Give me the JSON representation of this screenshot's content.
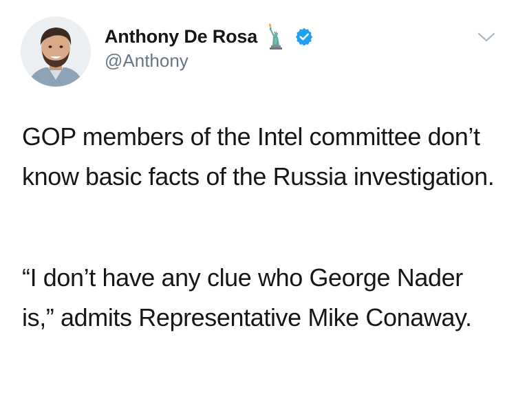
{
  "tweet": {
    "display_name": "Anthony De Rosa",
    "handle": "@Anthony",
    "paragraphs": [
      "GOP members of the Intel committee don’t know basic facts of the Russia investigation.",
      "“I don’t have any clue who George Nader is,” admits Representative Mike Conaway."
    ]
  },
  "icons": {
    "avatar": "profile-photo",
    "name_emoji": "statue-of-liberty-icon",
    "verified": "verified-badge-icon",
    "menu": "chevron-down-icon"
  },
  "colors": {
    "text": "#14171a",
    "secondary_text": "#657786",
    "verified_blue": "#1da1f2",
    "liberty_green": "#5fa89a"
  }
}
